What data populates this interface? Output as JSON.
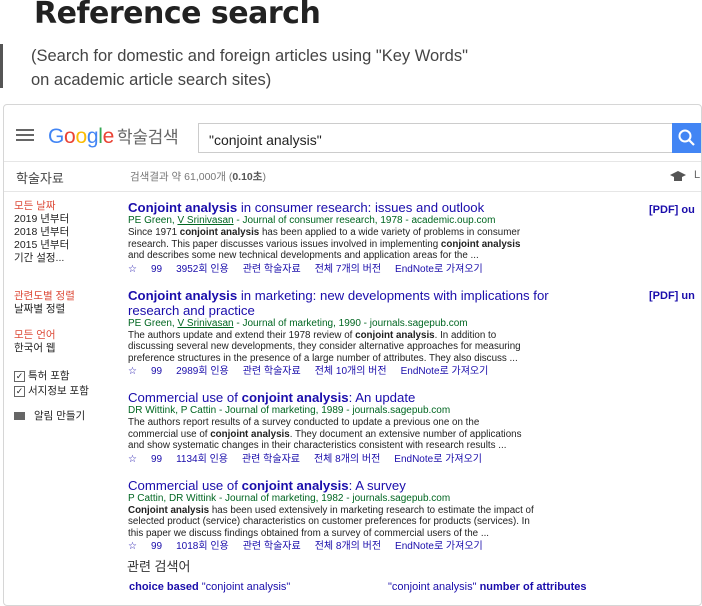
{
  "slide": {
    "title": "Reference search",
    "subtitle_line1": "(Search for domestic and foreign articles using \"Key Words\"",
    "subtitle_line2": "on academic article search sites)"
  },
  "header": {
    "logo_G": "G",
    "logo_o1": "o",
    "logo_o2": "o",
    "logo_g": "g",
    "logo_l": "l",
    "logo_e": "e",
    "logo_scholar": "학술검색",
    "search_value": "\"conjoint analysis\"",
    "search_icon": "search-icon",
    "menu_icon": "hamburger-menu-icon"
  },
  "toolbar": {
    "left_label": "학술자료",
    "count_prefix": "검색결과 약 61,000개 (",
    "count_time": "0.10초",
    "count_suffix": ")",
    "right_icon": "mortarboard-icon",
    "right_text": "L"
  },
  "sidebar": {
    "time": [
      "모든 날짜",
      "2019 년부터",
      "2018 년부터",
      "2015 년부터",
      "기간 설정..."
    ],
    "sort": [
      "관련도별 정렬",
      "날짜별 정렬"
    ],
    "lang": [
      "모든 언어",
      "한국어 웹"
    ],
    "checkboxes": [
      {
        "label": "특허 포함",
        "checked": true
      },
      {
        "label": "서지정보 포함",
        "checked": true
      }
    ],
    "alert_label": "알림 만들기",
    "alert_icon": "envelope-icon"
  },
  "results": [
    {
      "title_bold": "Conjoint analysis",
      "title_rest": " in consumer research: issues and outlook",
      "authors_a": "PE Green, ",
      "authors_u": "V Srinivasan",
      "source": " - Journal of consumer research, 1978 - academic.oup.com",
      "s1a": "Since 1971 ",
      "s1b": "conjoint analysis",
      "s1c": " has been applied to a wide variety of problems in consumer",
      "s2a": "research. This paper discusses various issues involved in implementing ",
      "s2b": "conjoint analysis",
      "s2c": "",
      "s3": "and describes some new technical developments and application areas for the ...",
      "cited": "3952회 인용",
      "related": "관련 학술자료",
      "versions": "전체 7개의 버전",
      "endnote": "EndNote로 가져오기",
      "pdf": "[PDF] ou"
    },
    {
      "title_bold": "Conjoint analysis",
      "title_rest": " in marketing: new developments with implications for",
      "title_line2": "research and practice",
      "authors_a": "PE Green, ",
      "authors_u": "V Srinivasan",
      "source": " - Journal of marketing, 1990 - journals.sagepub.com",
      "s1a": "The authors update and extend their 1978 review of ",
      "s1b": "conjoint analysis",
      "s1c": ". In addition to",
      "s2": "discussing several new developments, they consider alternative approaches for measuring",
      "s3": "preference structures in the presence of a large number of attributes. They also discuss ...",
      "cited": "2989회 인용",
      "related": "관련 학술자료",
      "versions": "전체 10개의 버전",
      "endnote": "EndNote로 가져오기",
      "pdf": "[PDF] un"
    },
    {
      "title_a": "Commercial use of ",
      "title_bold": "conjoint analysis",
      "title_rest": ": An update",
      "authors": "DR Wittink, P Cattin - Journal of marketing, 1989 - journals.sagepub.com",
      "s1": "The authors report results of a survey conducted to update a previous one on the",
      "s2a": "commercial use of ",
      "s2b": "conjoint analysis",
      "s2c": ". They document an extensive number of applications",
      "s3": "and show systematic changes in their characteristics consistent with research results ...",
      "cited": "1134회 인용",
      "related": "관련 학술자료",
      "versions": "전체 8개의 버전",
      "endnote": "EndNote로 가져오기"
    },
    {
      "title_a": "Commercial use of ",
      "title_bold": "conjoint analysis",
      "title_rest": ": A survey",
      "authors": "P Cattin, DR Wittink - Journal of marketing, 1982 - journals.sagepub.com",
      "s1a": "Conjoint analysis",
      "s1c": " has been used extensively in marketing research to estimate the impact of",
      "s2": "selected product (service) characteristics on customer preferences for products (services). In",
      "s3": "this paper we discuss findings obtained from a survey of commercial users of the ...",
      "cited": "1018회 인용",
      "related": "관련 학술자료",
      "versions": "전체 8개의 버전",
      "endnote": "EndNote로 가져오기"
    }
  ],
  "related_searches": {
    "heading": "관련 검색어",
    "items": [
      {
        "bold": "choice based ",
        "rest": "\"conjoint analysis\""
      },
      {
        "rest": "\"conjoint analysis\" ",
        "bold": "number of attributes"
      }
    ]
  },
  "icons": {
    "star": "☆",
    "quote": "99"
  },
  "colors": {
    "link": "#1a0dab",
    "green": "#006621",
    "red": "#dd4b39",
    "blue_button": "#4285f4"
  }
}
